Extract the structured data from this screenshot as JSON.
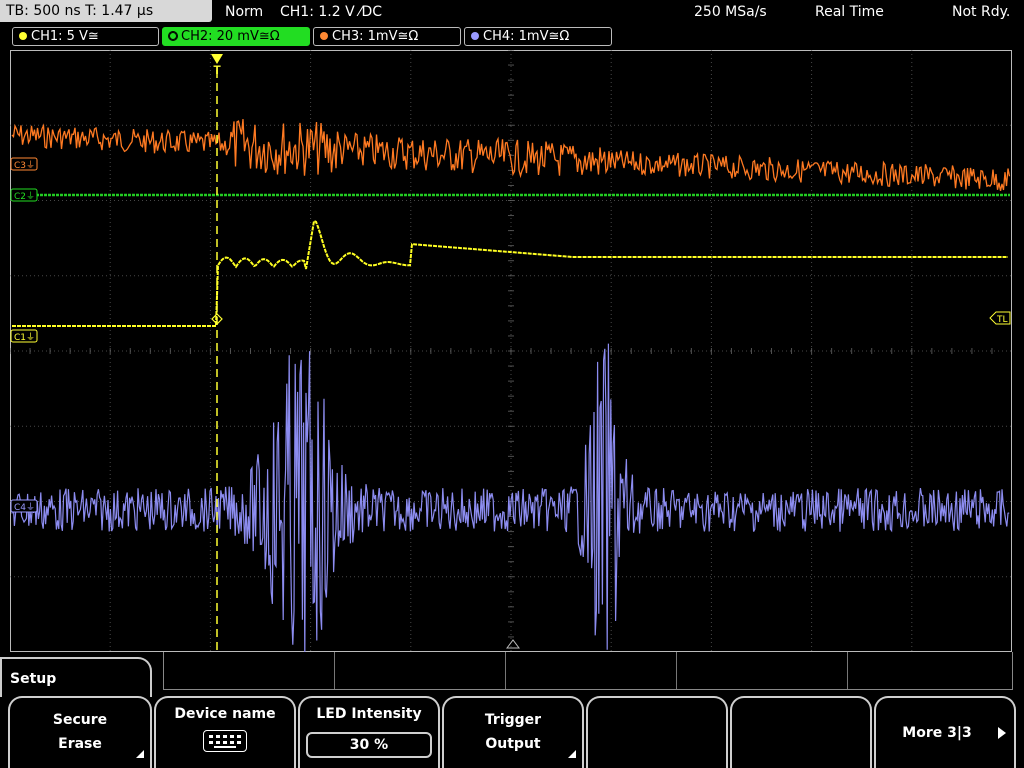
{
  "status": {
    "timebase": "TB: 500 ns   T: 1.47 µs",
    "mode": "Norm",
    "trigger": "CH1: 1.2 V ⁄DC",
    "sample_rate": "250 MSa/s",
    "acq_mode": "Real Time",
    "state": "Not Rdy."
  },
  "channels": [
    {
      "label": "CH1: 5 V≅",
      "color": "#ffff33"
    },
    {
      "label": "CH2: 20 mV≅Ω",
      "color": "#22dd22",
      "active": true
    },
    {
      "label": "CH3: 1mV≅Ω",
      "color": "#ff8833"
    },
    {
      "label": "CH4: 1mV≅Ω",
      "color": "#8888ff"
    }
  ],
  "markers": {
    "c3": "C3⏚",
    "c2": "C2⏚",
    "c1": "C1⏚",
    "c4": "C4⏚",
    "trigger_level": "TL",
    "trigger_pos": "T"
  },
  "menu": {
    "title": "Setup",
    "softkeys": {
      "secure_erase_1": "Secure",
      "secure_erase_2": "Erase",
      "device_name": "Device name",
      "led_label": "LED Intensity",
      "led_value": "30 %",
      "trigger_output_1": "Trigger",
      "trigger_output_2": "Output",
      "more": "More 3|3"
    }
  },
  "icons": [
    "keyboard-icon",
    "submenu-corner-icon",
    "next-page-arrow-icon"
  ]
}
